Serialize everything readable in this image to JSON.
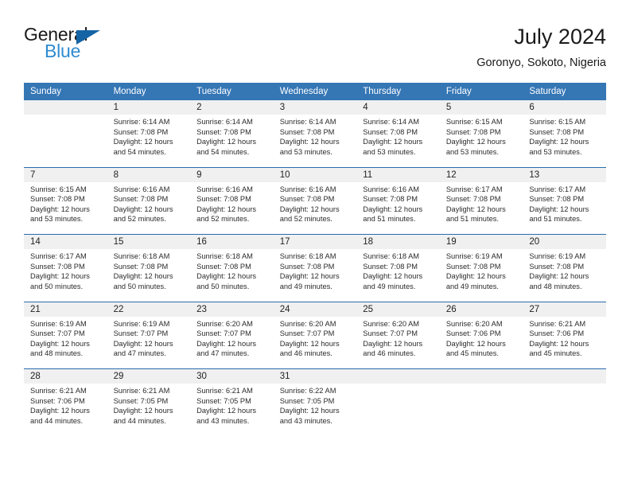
{
  "brand": {
    "name_part1": "General",
    "name_part2": "Blue",
    "flag_icon": "triangle-flag-icon",
    "accent_dark": "#1464a5",
    "accent_light": "#2e8bd0"
  },
  "header": {
    "title": "July 2024",
    "subtitle": "Goronyo, Sokoto, Nigeria"
  },
  "theme": {
    "header_bg": "#3576b5",
    "date_strip_bg": "#f0f0f0",
    "week_rule": "#2a6cae"
  },
  "weekdays": [
    "Sunday",
    "Monday",
    "Tuesday",
    "Wednesday",
    "Thursday",
    "Friday",
    "Saturday"
  ],
  "weeks": [
    {
      "days": [
        {
          "date": "",
          "sunrise": "",
          "sunset": "",
          "daylight_1": "",
          "daylight_2": ""
        },
        {
          "date": "1",
          "sunrise": "Sunrise: 6:14 AM",
          "sunset": "Sunset: 7:08 PM",
          "daylight_1": "Daylight: 12 hours",
          "daylight_2": "and 54 minutes."
        },
        {
          "date": "2",
          "sunrise": "Sunrise: 6:14 AM",
          "sunset": "Sunset: 7:08 PM",
          "daylight_1": "Daylight: 12 hours",
          "daylight_2": "and 54 minutes."
        },
        {
          "date": "3",
          "sunrise": "Sunrise: 6:14 AM",
          "sunset": "Sunset: 7:08 PM",
          "daylight_1": "Daylight: 12 hours",
          "daylight_2": "and 53 minutes."
        },
        {
          "date": "4",
          "sunrise": "Sunrise: 6:14 AM",
          "sunset": "Sunset: 7:08 PM",
          "daylight_1": "Daylight: 12 hours",
          "daylight_2": "and 53 minutes."
        },
        {
          "date": "5",
          "sunrise": "Sunrise: 6:15 AM",
          "sunset": "Sunset: 7:08 PM",
          "daylight_1": "Daylight: 12 hours",
          "daylight_2": "and 53 minutes."
        },
        {
          "date": "6",
          "sunrise": "Sunrise: 6:15 AM",
          "sunset": "Sunset: 7:08 PM",
          "daylight_1": "Daylight: 12 hours",
          "daylight_2": "and 53 minutes."
        }
      ]
    },
    {
      "days": [
        {
          "date": "7",
          "sunrise": "Sunrise: 6:15 AM",
          "sunset": "Sunset: 7:08 PM",
          "daylight_1": "Daylight: 12 hours",
          "daylight_2": "and 53 minutes."
        },
        {
          "date": "8",
          "sunrise": "Sunrise: 6:16 AM",
          "sunset": "Sunset: 7:08 PM",
          "daylight_1": "Daylight: 12 hours",
          "daylight_2": "and 52 minutes."
        },
        {
          "date": "9",
          "sunrise": "Sunrise: 6:16 AM",
          "sunset": "Sunset: 7:08 PM",
          "daylight_1": "Daylight: 12 hours",
          "daylight_2": "and 52 minutes."
        },
        {
          "date": "10",
          "sunrise": "Sunrise: 6:16 AM",
          "sunset": "Sunset: 7:08 PM",
          "daylight_1": "Daylight: 12 hours",
          "daylight_2": "and 52 minutes."
        },
        {
          "date": "11",
          "sunrise": "Sunrise: 6:16 AM",
          "sunset": "Sunset: 7:08 PM",
          "daylight_1": "Daylight: 12 hours",
          "daylight_2": "and 51 minutes."
        },
        {
          "date": "12",
          "sunrise": "Sunrise: 6:17 AM",
          "sunset": "Sunset: 7:08 PM",
          "daylight_1": "Daylight: 12 hours",
          "daylight_2": "and 51 minutes."
        },
        {
          "date": "13",
          "sunrise": "Sunrise: 6:17 AM",
          "sunset": "Sunset: 7:08 PM",
          "daylight_1": "Daylight: 12 hours",
          "daylight_2": "and 51 minutes."
        }
      ]
    },
    {
      "days": [
        {
          "date": "14",
          "sunrise": "Sunrise: 6:17 AM",
          "sunset": "Sunset: 7:08 PM",
          "daylight_1": "Daylight: 12 hours",
          "daylight_2": "and 50 minutes."
        },
        {
          "date": "15",
          "sunrise": "Sunrise: 6:18 AM",
          "sunset": "Sunset: 7:08 PM",
          "daylight_1": "Daylight: 12 hours",
          "daylight_2": "and 50 minutes."
        },
        {
          "date": "16",
          "sunrise": "Sunrise: 6:18 AM",
          "sunset": "Sunset: 7:08 PM",
          "daylight_1": "Daylight: 12 hours",
          "daylight_2": "and 50 minutes."
        },
        {
          "date": "17",
          "sunrise": "Sunrise: 6:18 AM",
          "sunset": "Sunset: 7:08 PM",
          "daylight_1": "Daylight: 12 hours",
          "daylight_2": "and 49 minutes."
        },
        {
          "date": "18",
          "sunrise": "Sunrise: 6:18 AM",
          "sunset": "Sunset: 7:08 PM",
          "daylight_1": "Daylight: 12 hours",
          "daylight_2": "and 49 minutes."
        },
        {
          "date": "19",
          "sunrise": "Sunrise: 6:19 AM",
          "sunset": "Sunset: 7:08 PM",
          "daylight_1": "Daylight: 12 hours",
          "daylight_2": "and 49 minutes."
        },
        {
          "date": "20",
          "sunrise": "Sunrise: 6:19 AM",
          "sunset": "Sunset: 7:08 PM",
          "daylight_1": "Daylight: 12 hours",
          "daylight_2": "and 48 minutes."
        }
      ]
    },
    {
      "days": [
        {
          "date": "21",
          "sunrise": "Sunrise: 6:19 AM",
          "sunset": "Sunset: 7:07 PM",
          "daylight_1": "Daylight: 12 hours",
          "daylight_2": "and 48 minutes."
        },
        {
          "date": "22",
          "sunrise": "Sunrise: 6:19 AM",
          "sunset": "Sunset: 7:07 PM",
          "daylight_1": "Daylight: 12 hours",
          "daylight_2": "and 47 minutes."
        },
        {
          "date": "23",
          "sunrise": "Sunrise: 6:20 AM",
          "sunset": "Sunset: 7:07 PM",
          "daylight_1": "Daylight: 12 hours",
          "daylight_2": "and 47 minutes."
        },
        {
          "date": "24",
          "sunrise": "Sunrise: 6:20 AM",
          "sunset": "Sunset: 7:07 PM",
          "daylight_1": "Daylight: 12 hours",
          "daylight_2": "and 46 minutes."
        },
        {
          "date": "25",
          "sunrise": "Sunrise: 6:20 AM",
          "sunset": "Sunset: 7:07 PM",
          "daylight_1": "Daylight: 12 hours",
          "daylight_2": "and 46 minutes."
        },
        {
          "date": "26",
          "sunrise": "Sunrise: 6:20 AM",
          "sunset": "Sunset: 7:06 PM",
          "daylight_1": "Daylight: 12 hours",
          "daylight_2": "and 45 minutes."
        },
        {
          "date": "27",
          "sunrise": "Sunrise: 6:21 AM",
          "sunset": "Sunset: 7:06 PM",
          "daylight_1": "Daylight: 12 hours",
          "daylight_2": "and 45 minutes."
        }
      ]
    },
    {
      "days": [
        {
          "date": "28",
          "sunrise": "Sunrise: 6:21 AM",
          "sunset": "Sunset: 7:06 PM",
          "daylight_1": "Daylight: 12 hours",
          "daylight_2": "and 44 minutes."
        },
        {
          "date": "29",
          "sunrise": "Sunrise: 6:21 AM",
          "sunset": "Sunset: 7:05 PM",
          "daylight_1": "Daylight: 12 hours",
          "daylight_2": "and 44 minutes."
        },
        {
          "date": "30",
          "sunrise": "Sunrise: 6:21 AM",
          "sunset": "Sunset: 7:05 PM",
          "daylight_1": "Daylight: 12 hours",
          "daylight_2": "and 43 minutes."
        },
        {
          "date": "31",
          "sunrise": "Sunrise: 6:22 AM",
          "sunset": "Sunset: 7:05 PM",
          "daylight_1": "Daylight: 12 hours",
          "daylight_2": "and 43 minutes."
        },
        {
          "date": "",
          "sunrise": "",
          "sunset": "",
          "daylight_1": "",
          "daylight_2": ""
        },
        {
          "date": "",
          "sunrise": "",
          "sunset": "",
          "daylight_1": "",
          "daylight_2": ""
        },
        {
          "date": "",
          "sunrise": "",
          "sunset": "",
          "daylight_1": "",
          "daylight_2": ""
        }
      ]
    }
  ]
}
